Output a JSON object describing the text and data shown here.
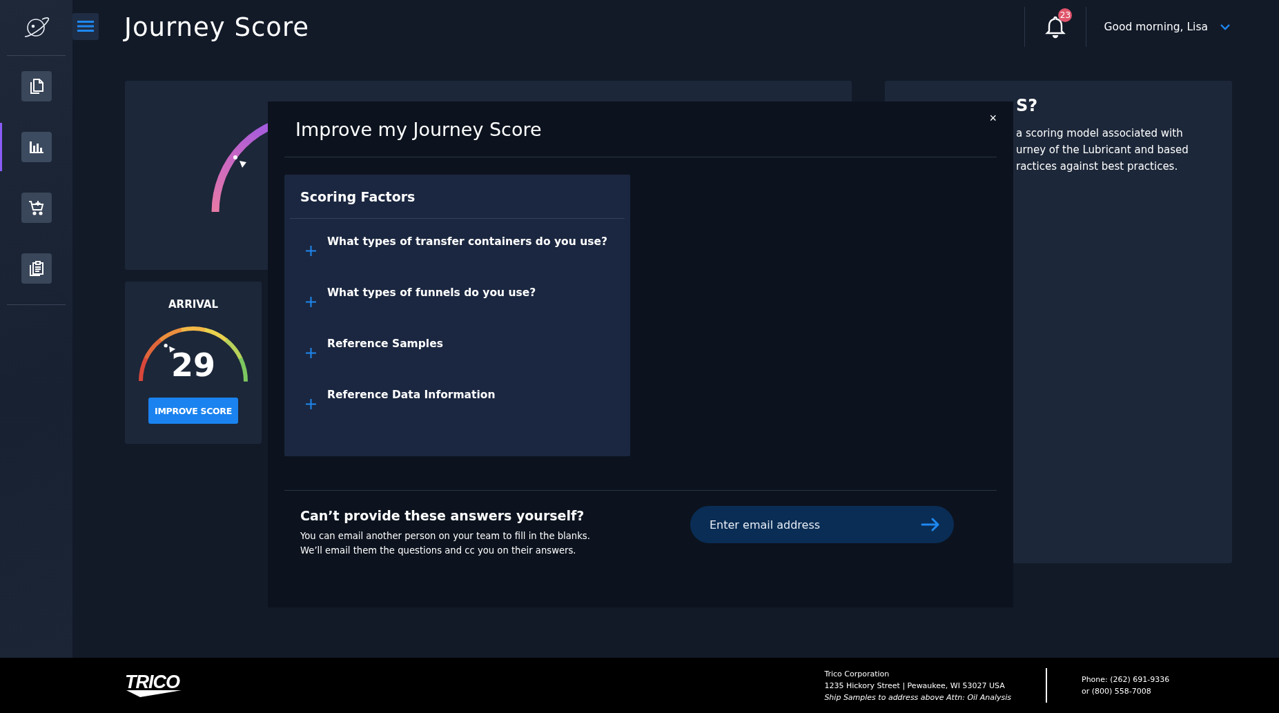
{
  "sidebar": {
    "nav_items": [
      {
        "kind": "documents",
        "selected": false
      },
      {
        "kind": "chart",
        "selected": true
      },
      {
        "kind": "cart",
        "selected": false
      },
      {
        "kind": "clipboard",
        "selected": false
      }
    ]
  },
  "header": {
    "title": "Journey Score",
    "notification_count": "23",
    "greeting": "Good morning, Lisa"
  },
  "arrival_card": {
    "label": "ARRIVAL",
    "score": "29",
    "level": 0.29,
    "button": "IMPROVE SCORE"
  },
  "info_card": {
    "heading": "S?",
    "text_lines": [
      "a scoring model associated with",
      "urney of the Lubricant and based",
      "ractices against best practices."
    ]
  },
  "modal": {
    "title": "Improve my Journey Score",
    "close": "×",
    "scoring_factors": {
      "title": "Scoring Factors",
      "items": [
        {
          "label": "What types of transfer containers do you use?",
          "expanded": false
        },
        {
          "label": "What types of funnels do you use?",
          "expanded": false
        },
        {
          "label": "Reference Samples",
          "expanded": false
        },
        {
          "label": "Reference Data Information",
          "expanded": false
        }
      ]
    },
    "help": {
      "heading": "Can’t provide these answers yourself?",
      "text_lines": [
        "You can email another person on your team to fill in the blanks.",
        "We’ll email them the questions and cc you on their answers."
      ],
      "email_field": {
        "placeholder": "Enter email address"
      }
    }
  },
  "footer": {
    "logo": "TRICO",
    "company": "Trico Corporation",
    "address": "1235 Hickory Street | Pewaukee, WI 53027 USA",
    "note": "Ship Samples to address above Attn: Oil Analysis",
    "phone": "Phone: (262) 691-9336",
    "phone_alt": "or (800) 558-7008"
  }
}
